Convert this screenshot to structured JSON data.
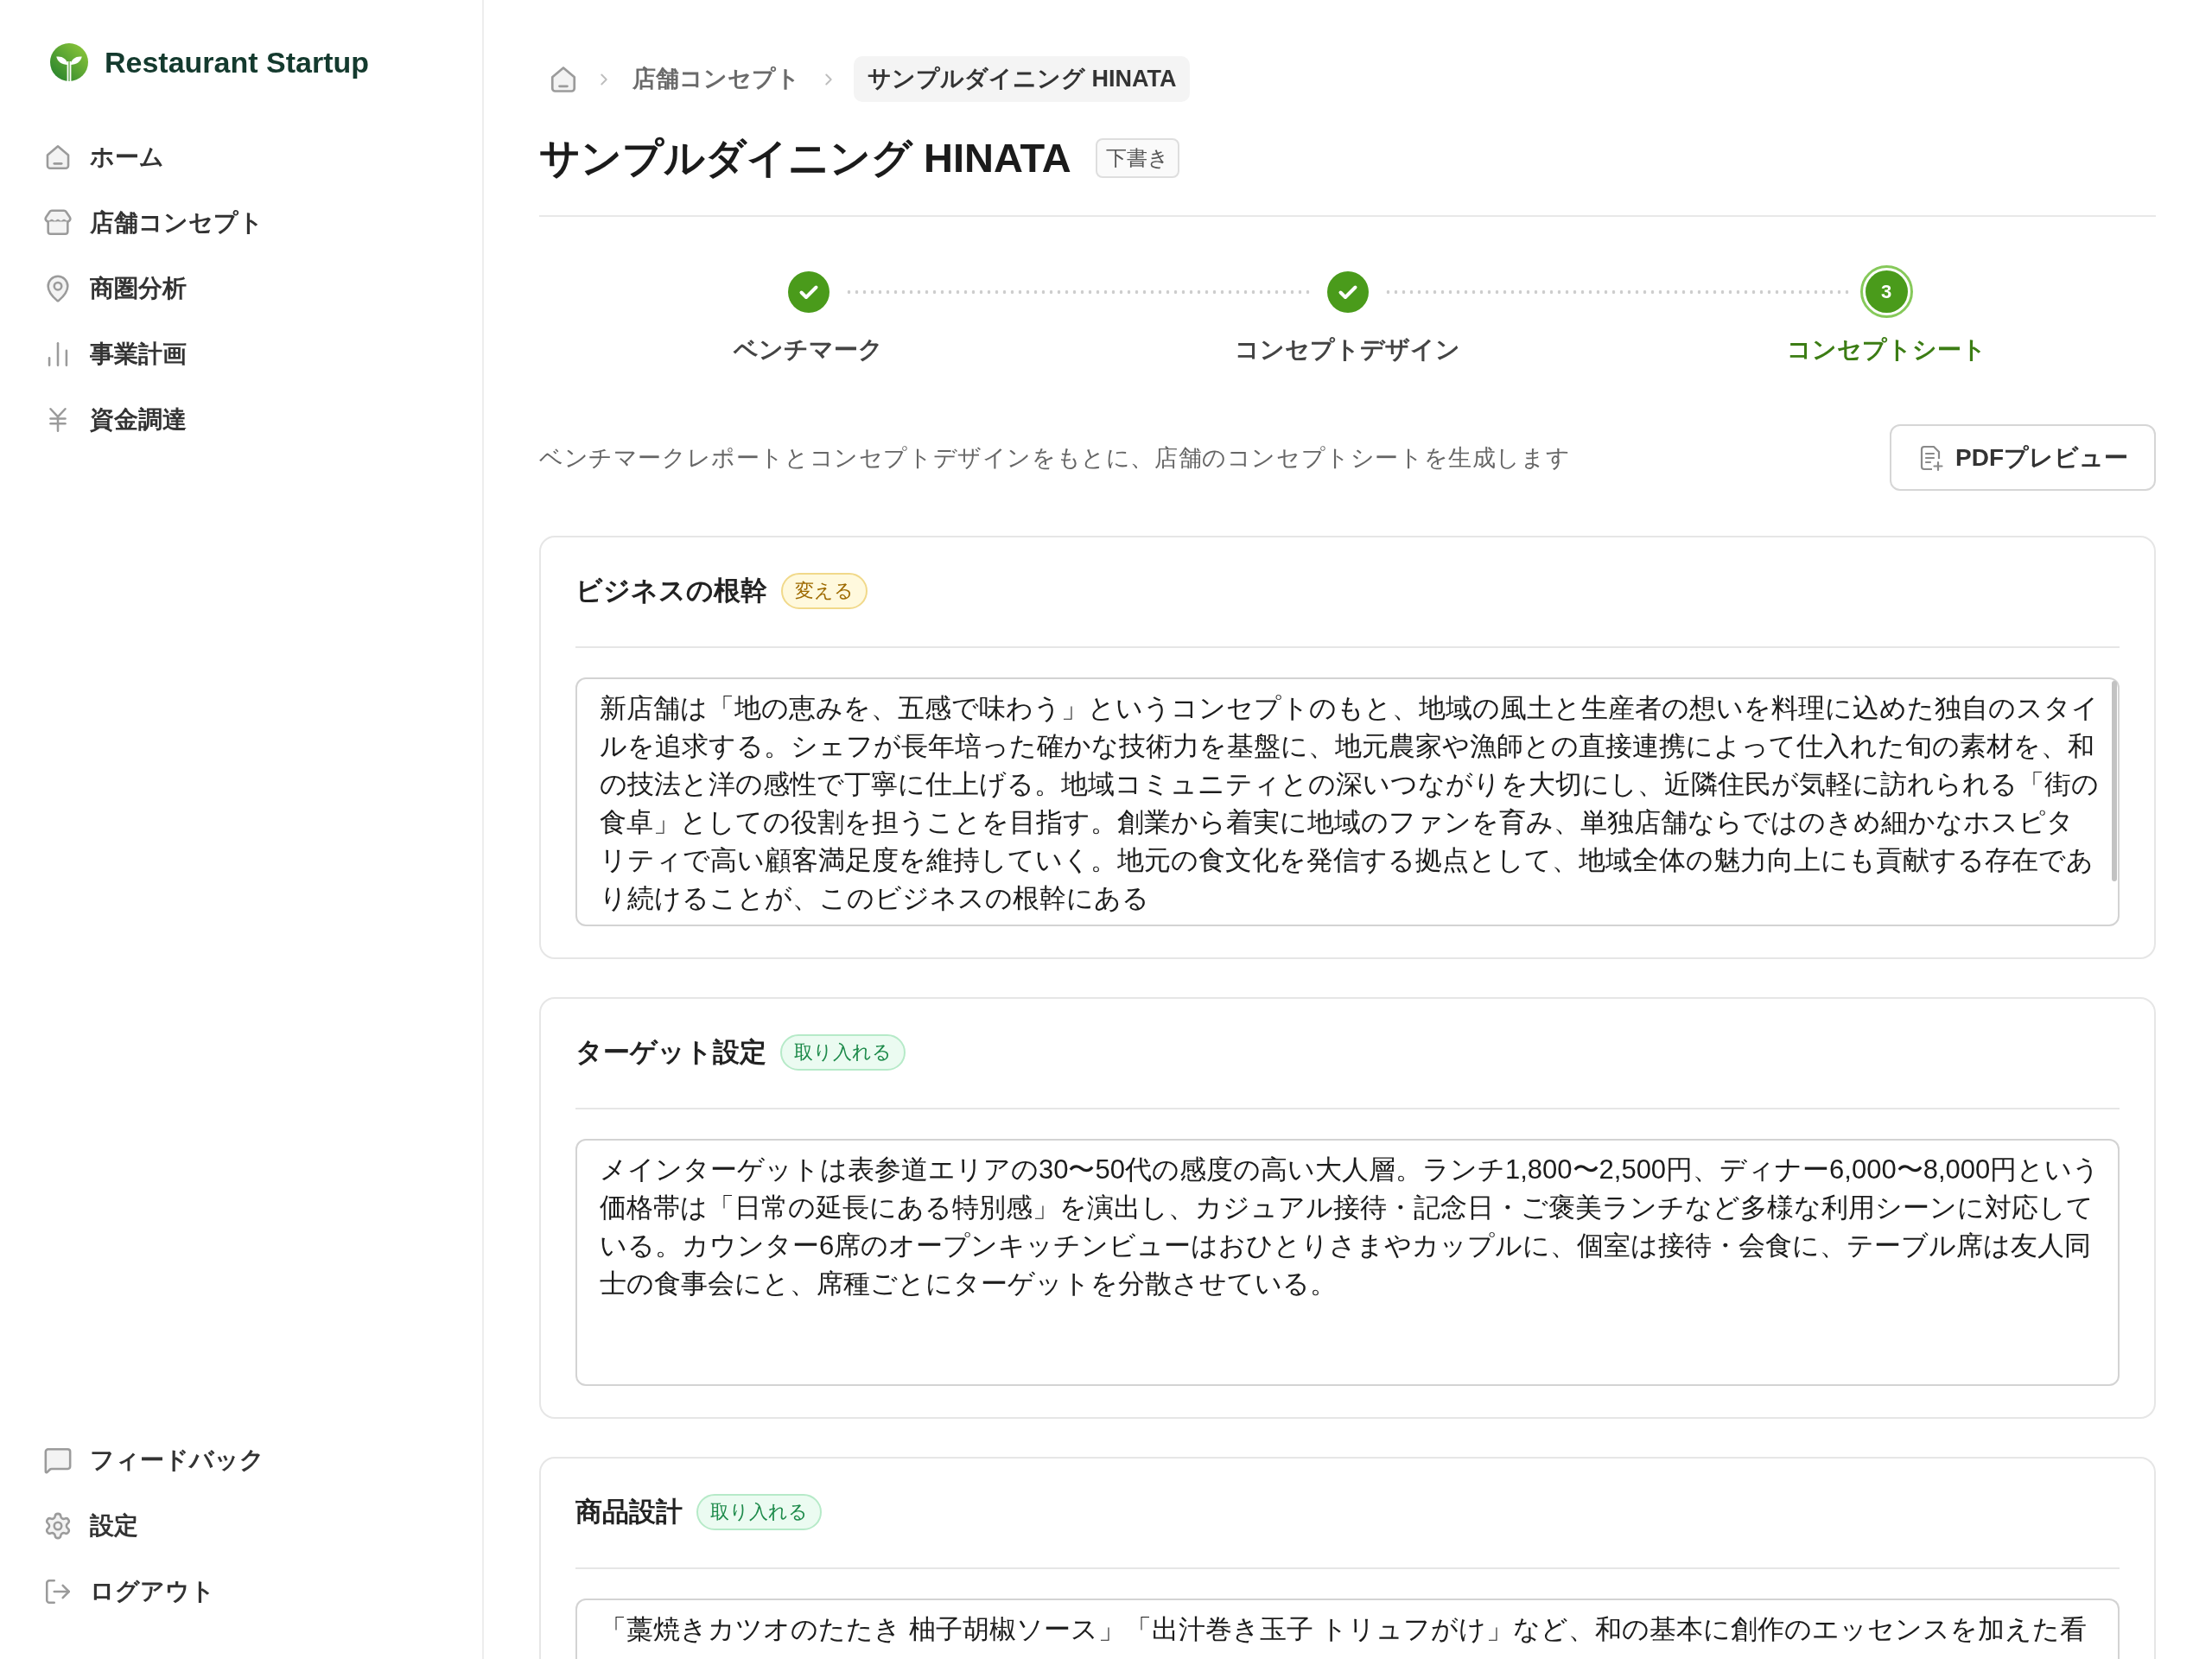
{
  "sidebar": {
    "brand": "Restaurant Startup",
    "nav_items": [
      {
        "label": "ホーム",
        "selected": false
      },
      {
        "label": "店舗コンセプト",
        "selected": false
      },
      {
        "label": "商圏分析",
        "selected": false
      },
      {
        "label": "事業計画",
        "selected": false
      },
      {
        "label": "資金調達",
        "selected": false
      }
    ],
    "footer_items": [
      {
        "label": "フィードバック"
      },
      {
        "label": "設定"
      },
      {
        "label": "ログアウト"
      }
    ]
  },
  "breadcrumb": {
    "items": [
      {
        "label": "店舗コンセプト",
        "selected": false
      },
      {
        "label": "サンプルダイニング HINATA",
        "selected": true
      }
    ]
  },
  "page": {
    "title": "サンプルダイニング HINATA",
    "status_badge": "下書き"
  },
  "stepper": {
    "steps": [
      {
        "label": "ベンチマーク",
        "completed": true,
        "selected": false
      },
      {
        "label": "コンセプトデザイン",
        "completed": true,
        "selected": false
      },
      {
        "label": "コンセプトシート",
        "number": "3",
        "completed": false,
        "selected": true
      }
    ]
  },
  "toolbar": {
    "description": "ベンチマークレポートとコンセプトデザインをもとに、店舗のコンセプトシートを生成します",
    "pdf_button": "PDFプレビュー"
  },
  "sections": [
    {
      "title": "ビジネスの根幹",
      "badge": {
        "label": "変える",
        "kind": "change"
      },
      "text": "新店舗は「地の恵みを、五感で味わう」というコンセプトのもと、地域の風土と生産者の想いを料理に込めた独自のスタイルを追求する。シェフが長年培った確かな技術力を基盤に、地元農家や漁師との直接連携によって仕入れた旬の素材を、和の技法と洋の感性で丁寧に仕上げる。地域コミュニティとの深いつながりを大切にし、近隣住民が気軽に訪れられる「街の食卓」としての役割を担うことを目指す。創業から着実に地域のファンを育み、単独店舗ならではのきめ細かなホスピタリティで高い顧客満足度を維持していく。地元の食文化を発信する拠点として、地域全体の魅力向上にも貢献する存在であり続けることが、このビジネスの根幹にある"
    },
    {
      "title": "ターゲット設定",
      "badge": {
        "label": "取り入れる",
        "kind": "adopt"
      },
      "text": "メインターゲットは表参道エリアの30〜50代の感度の高い大人層。ランチ1,800〜2,500円、ディナー6,000〜8,000円という価格帯は「日常の延長にある特別感」を演出し、カジュアル接待・記念日・ご褒美ランチなど多様な利用シーンに対応している。カウンター6席のオープンキッチンビューはおひとりさまやカップルに、個室は接待・会食に、テーブル席は友人同士の食事会にと、席種ごとにターゲットを分散させている。"
    },
    {
      "title": "商品設計",
      "badge": {
        "label": "取り入れる",
        "kind": "adopt"
      },
      "text": "「藁焼きカツオのたたき 柚子胡椒ソース」「出汁巻き玉子 トリュフがけ」など、和の基本に創作のエッセンスを加えた看"
    }
  ]
}
